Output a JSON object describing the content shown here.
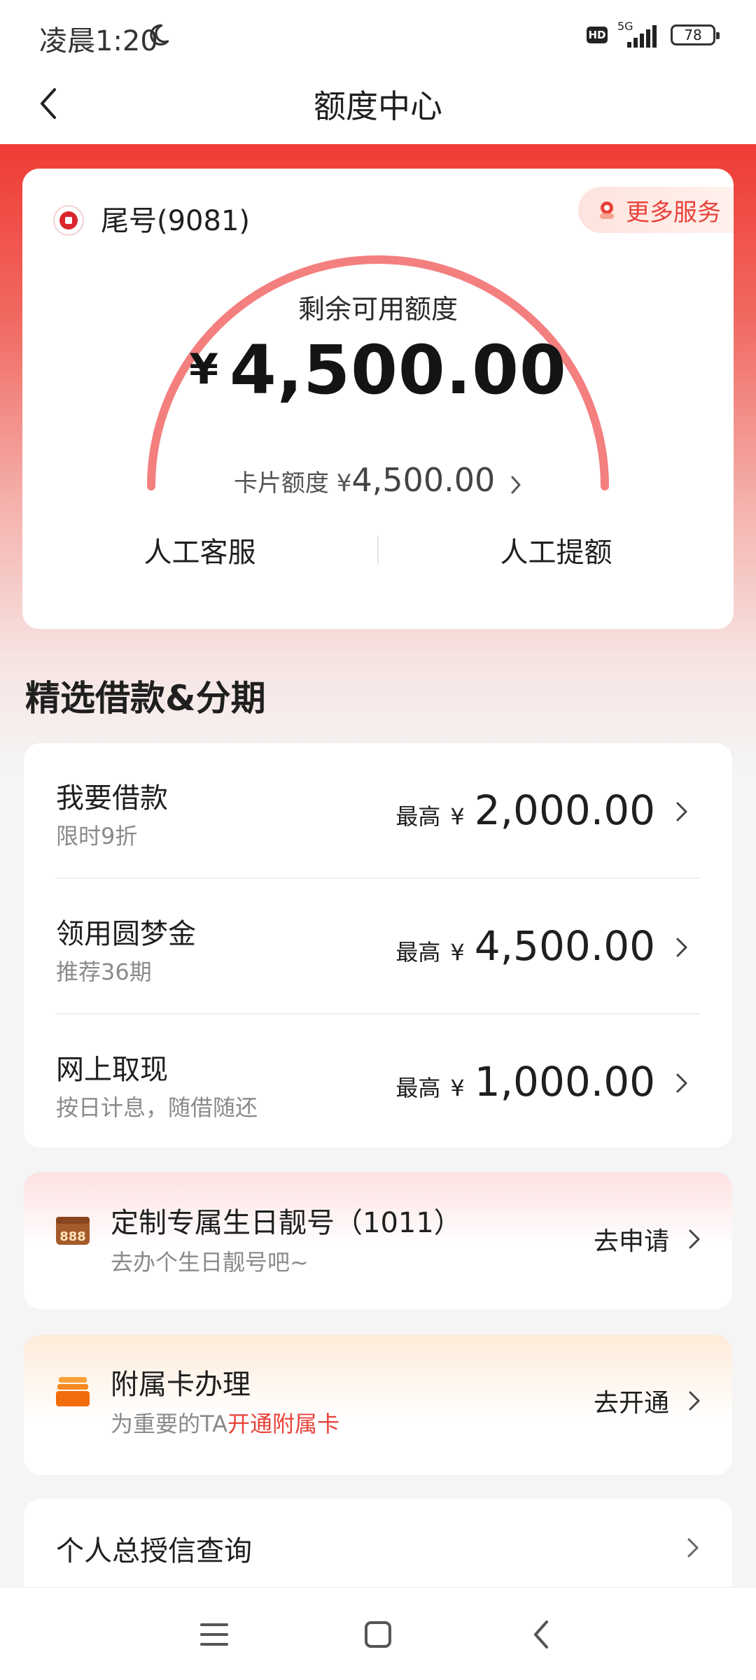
{
  "status_bar": {
    "time": "凌晨1:20",
    "network": "5G",
    "hd": "HD",
    "battery": "78"
  },
  "nav": {
    "title": "额度中心"
  },
  "quota_card": {
    "card_tail": "尾号(9081)",
    "more_services": "更多服务",
    "remaining_label": "剩余可用额度",
    "currency": "¥",
    "remaining_amount": "4,500.00",
    "card_limit_label": "卡片额度 ¥",
    "card_limit_value": "4,500.00",
    "actions": [
      "人工客服",
      "人工提额"
    ]
  },
  "section_title": "精选借款&分期",
  "loans": [
    {
      "title": "我要借款",
      "subtitle": "限时9折",
      "prefix": "最高",
      "currency": "¥",
      "amount": "2,000.00"
    },
    {
      "title": "领用圆梦金",
      "subtitle": "推荐36期",
      "prefix": "最高",
      "currency": "¥",
      "amount": "4,500.00"
    },
    {
      "title": "网上取现",
      "subtitle": "按日计息，随借随还",
      "prefix": "最高",
      "currency": "¥",
      "amount": "1,000.00"
    }
  ],
  "promos": {
    "birthday": {
      "icon_text": "888",
      "title": "定制专属生日靓号（1011）",
      "subtitle": "去办个生日靓号吧~",
      "action": "去申请"
    },
    "subcard": {
      "title": "附属卡办理",
      "subtitle_prefix": "为重要的TA",
      "subtitle_highlight": "开通附属卡",
      "action": "去开通"
    }
  },
  "credit_query": {
    "label": "个人总授信查询"
  },
  "colors": {
    "brand_red": "#e8433a",
    "arc": "#f47f7f"
  }
}
